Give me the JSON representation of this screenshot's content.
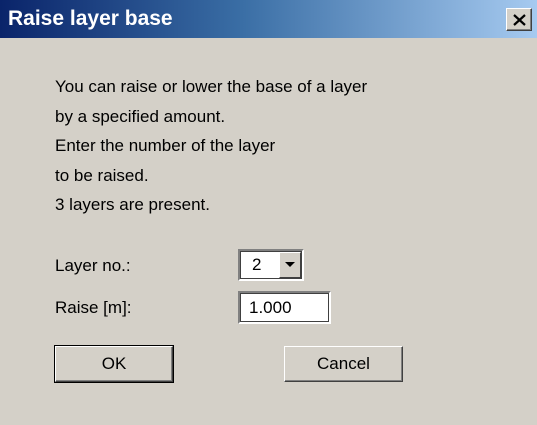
{
  "window": {
    "title": "Raise layer base",
    "close_glyph": "×"
  },
  "message": {
    "lines": [
      "You can raise or lower the base of a layer",
      "by a specified amount.",
      "Enter the number of the layer",
      "to be raised.",
      "3 layers are present."
    ]
  },
  "layer_field": {
    "label": "Layer no.:",
    "value": "2"
  },
  "raise_field": {
    "label": "Raise [m]:",
    "value": "1.000"
  },
  "buttons": {
    "ok": "OK",
    "cancel": "Cancel"
  },
  "colors": {
    "face": "#d4d0c8",
    "title_start": "#0a246a",
    "title_end": "#a6caf0"
  },
  "icons": {
    "close": "close-icon",
    "dropdown": "chevron-down-icon"
  }
}
